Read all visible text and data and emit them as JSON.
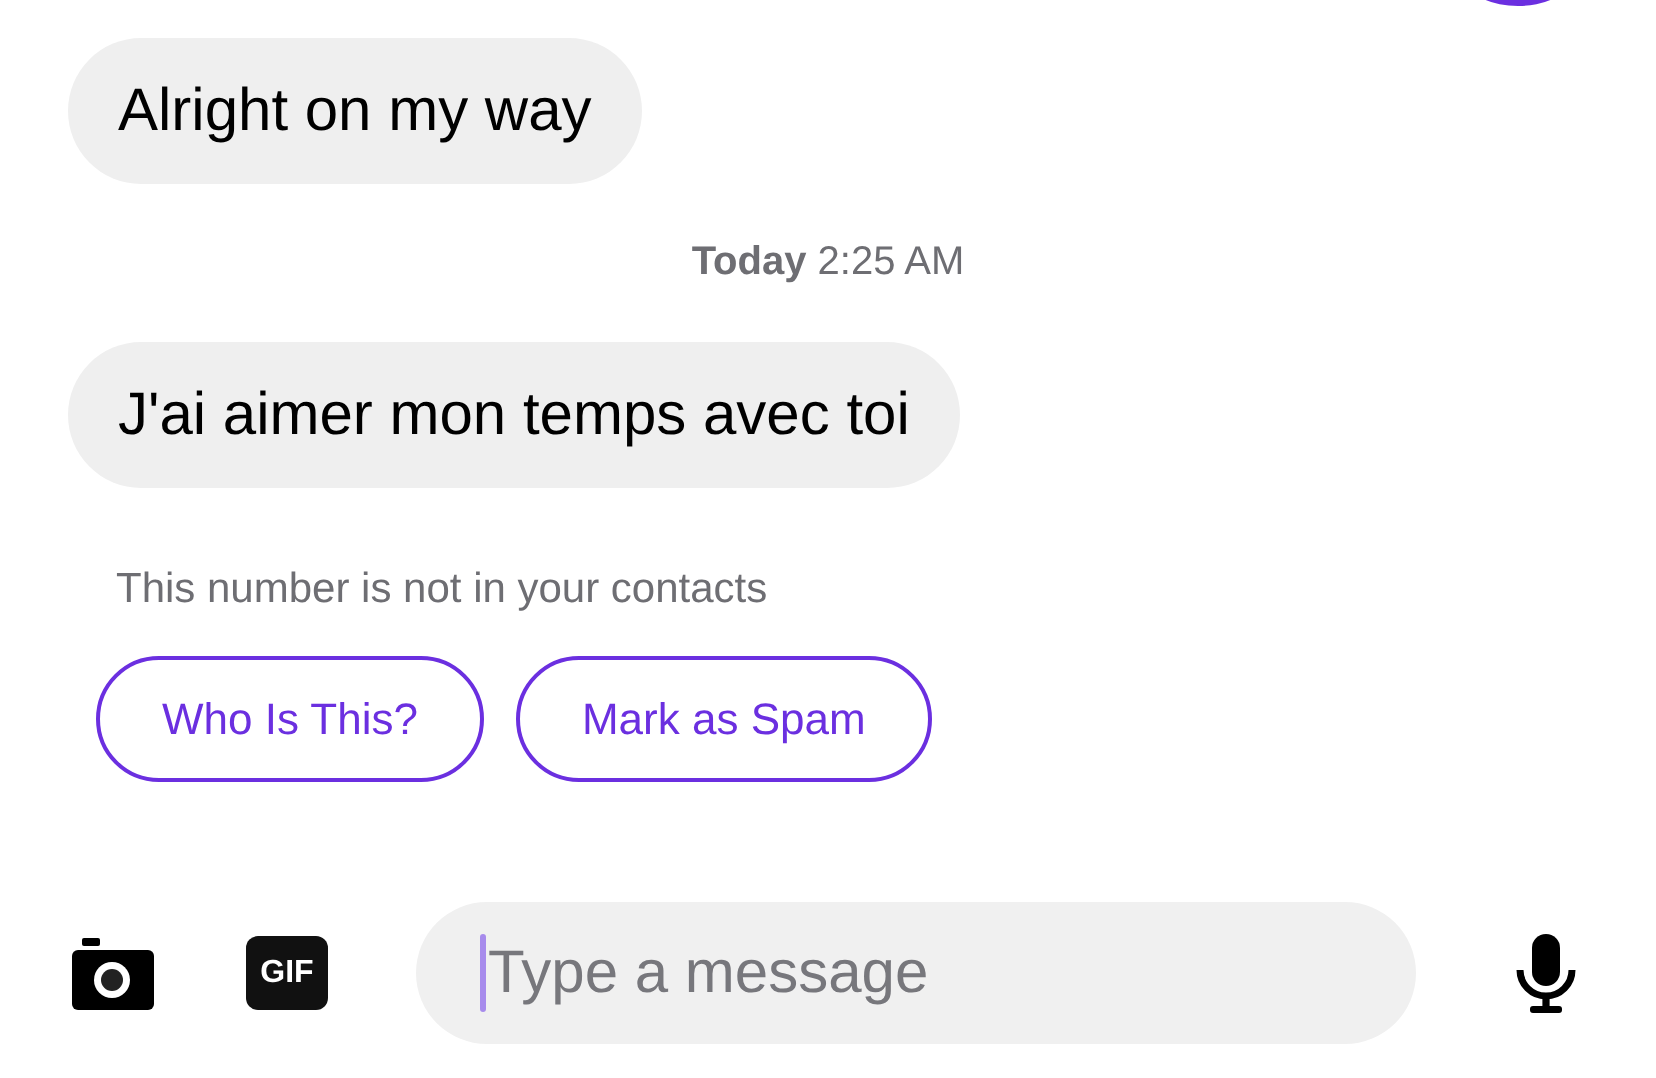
{
  "messages": [
    {
      "kind": "bubble",
      "text": "Alright on my way"
    },
    {
      "kind": "timestamp",
      "text": "**Today** 2:25 AM"
    },
    {
      "kind": "bubble",
      "text": "J'ai aimer mon temps avec toi"
    }
  ],
  "unknown_sender": {
    "notice": "This number is not in your contacts",
    "actions": [
      "Who Is This?",
      "Mark as Spam"
    ]
  },
  "composer": {
    "gif_label": "GIF",
    "placeholder": "Type a message"
  }
}
